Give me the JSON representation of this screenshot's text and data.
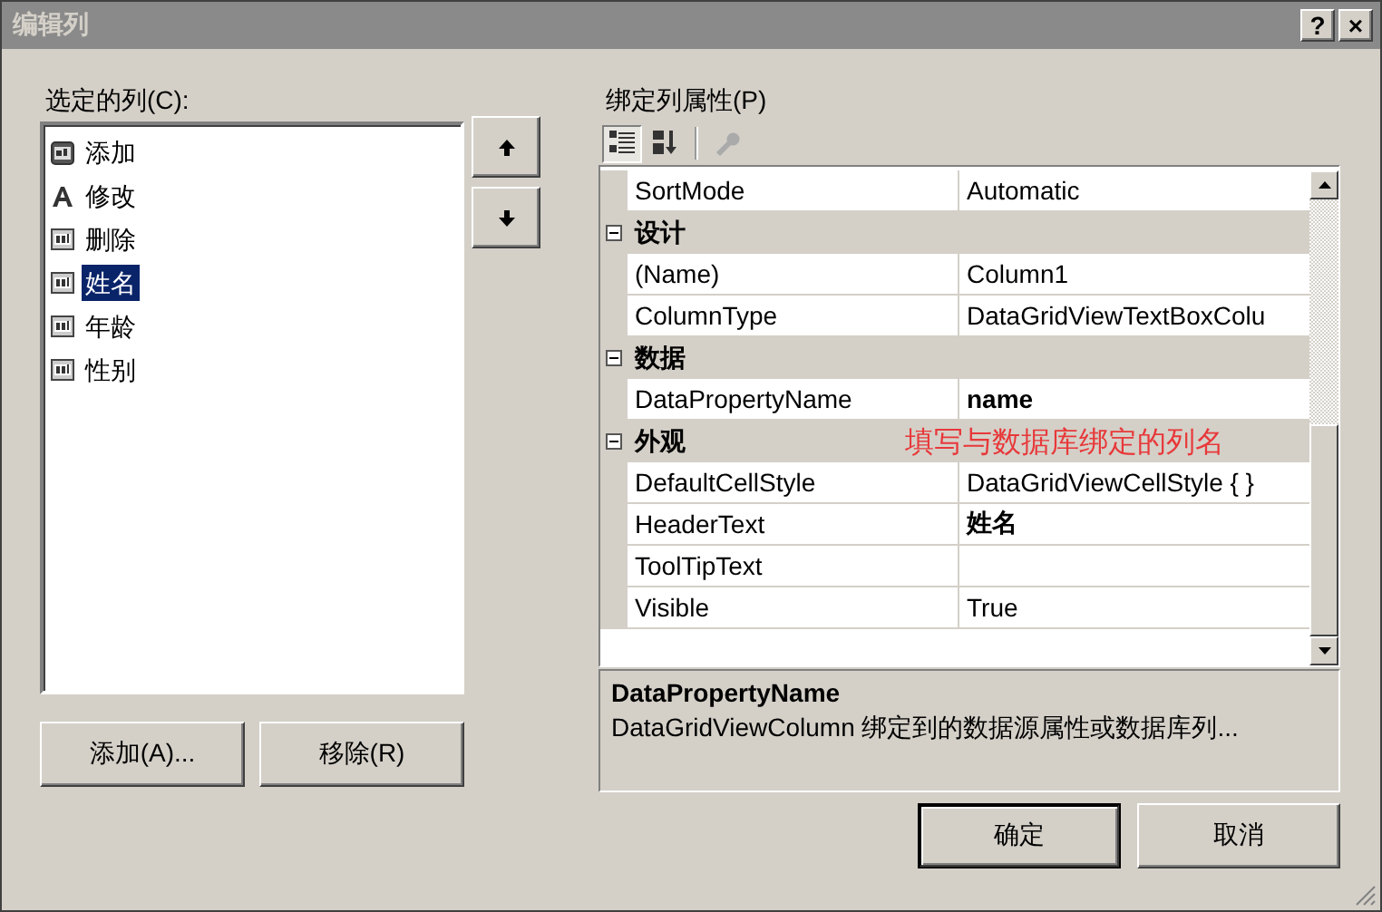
{
  "window": {
    "title": "编辑列",
    "title_buttons": [
      "?",
      "×"
    ]
  },
  "columns_list": {
    "label": "选定的列(C):",
    "items": [
      {
        "text": "添加",
        "kind": "button",
        "selected": false
      },
      {
        "text": "修改",
        "kind": "label",
        "selected": false
      },
      {
        "text": "删除",
        "kind": "textbox",
        "selected": false
      },
      {
        "text": "姓名",
        "kind": "textbox",
        "selected": true
      },
      {
        "text": "年龄",
        "kind": "textbox",
        "selected": false
      },
      {
        "text": "性别",
        "kind": "textbox",
        "selected": false
      }
    ],
    "buttons": [
      "添加(A)...",
      "移除(R)"
    ]
  },
  "properties": {
    "label": "绑定列属性(P)",
    "toolbar": [
      {
        "kind": "categorized",
        "selected": true,
        "disabled": false
      },
      {
        "kind": "alphabetical",
        "selected": false,
        "disabled": false
      },
      {
        "kind": "pages",
        "selected": false,
        "disabled": true
      }
    ],
    "rows": [
      {
        "kind": "property",
        "name": "SortMode",
        "value": "Automatic",
        "modified": false
      },
      {
        "kind": "category",
        "name": "设计",
        "expanded": true
      },
      {
        "kind": "property",
        "name": "(Name)",
        "value": "Column1",
        "modified": false
      },
      {
        "kind": "property",
        "name": "ColumnType",
        "value": "DataGridViewTextBoxColu",
        "modified": false
      },
      {
        "kind": "category",
        "name": "数据",
        "expanded": true
      },
      {
        "kind": "property",
        "name": "DataPropertyName",
        "value": "name",
        "modified": true
      },
      {
        "kind": "category",
        "name": "外观",
        "expanded": true,
        "note": "填写与数据库绑定的列名"
      },
      {
        "kind": "property",
        "name": "DefaultCellStyle",
        "value": "DataGridViewCellStyle { }",
        "modified": false
      },
      {
        "kind": "property",
        "name": "HeaderText",
        "value": "姓名",
        "modified": true
      },
      {
        "kind": "property",
        "name": "ToolTipText"
      },
      {
        "kind": "property",
        "name": "Visible",
        "value": "True",
        "modified": false
      }
    ],
    "description": {
      "title": "DataPropertyName",
      "text": "DataGridViewColumn 绑定到的数据源属性或数据库列..."
    }
  },
  "buttons": [
    {
      "text": "确定",
      "default": true
    },
    {
      "text": "取消",
      "default": false
    }
  ]
}
